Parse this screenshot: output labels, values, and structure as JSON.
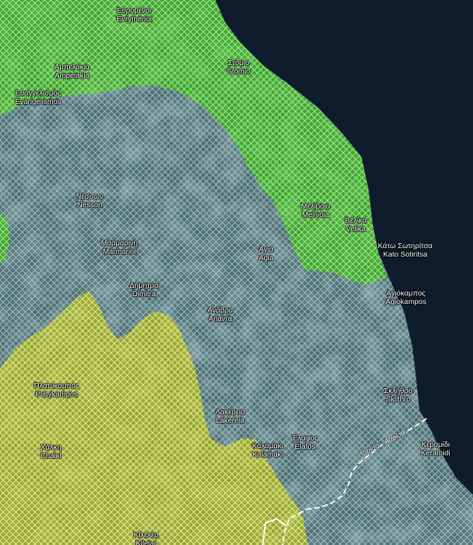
{
  "map": {
    "colors": {
      "sea": "#0f1c2e",
      "land": "#4c5a55",
      "zone_green": "#3fcf1d",
      "zone_blue": "#7fc1d8",
      "zone_yellow": "#c7d023"
    },
    "places": [
      {
        "greek": "Ευρυμένοι",
        "latin": "Evrymenoi"
      },
      {
        "greek": "Αμπελάκια",
        "latin": "Ampelakia"
      },
      {
        "greek": "Στόμιο",
        "latin": "Stomio"
      },
      {
        "greek": "Ευαγγελισμός",
        "latin": "Evangelismos"
      },
      {
        "greek": "Νέσσων",
        "latin": "Nesson"
      },
      {
        "greek": "Μελίβοια",
        "latin": "Melivoia"
      },
      {
        "greek": "Βελίκα",
        "latin": "Velika"
      },
      {
        "greek": "Μαρμαρινή",
        "latin": "Marmarini"
      },
      {
        "greek": "Αγιά",
        "latin": "Agia"
      },
      {
        "greek": "Κάτω Σωτηρίτσα",
        "latin": "Kato Sotiritsa"
      },
      {
        "greek": "Δήμητρα",
        "latin": "Dimitra"
      },
      {
        "greek": "Αγιόκαμπος",
        "latin": "Agiokampos"
      },
      {
        "greek": "Ανάβρα",
        "latin": "Anavra"
      },
      {
        "greek": "Πλατύκαμπος",
        "latin": "Platykampos"
      },
      {
        "greek": "Σκλήθρο",
        "latin": "Sklithro"
      },
      {
        "greek": "Λακέρεια",
        "latin": "Lakereia"
      },
      {
        "greek": "Έλαφος",
        "latin": "Elafos"
      },
      {
        "greek": "Καλαμάκι",
        "latin": "Kalamaki"
      },
      {
        "greek": "Κεραμίδι",
        "latin": "Keramidi"
      },
      {
        "greek": "Χάλκη",
        "latin": "Chalki"
      },
      {
        "greek": "Κιλελέρ",
        "latin": "Kilelar"
      }
    ],
    "road_label": "Λάρισα - Λαρίσα"
  }
}
